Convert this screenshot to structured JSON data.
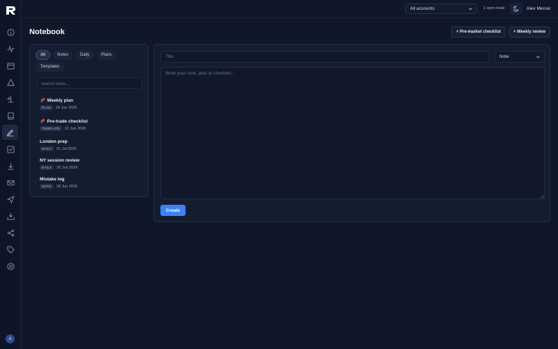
{
  "app": {
    "logo": "R"
  },
  "sidebar": {
    "icons": [
      "info-icon",
      "activity-icon",
      "calendar-icon",
      "warning-icon",
      "scale-icon",
      "book-icon",
      "pen-icon",
      "checklist-icon",
      "download-icon",
      "mail-icon",
      "send-icon",
      "inbox-icon",
      "share-icon",
      "tag-icon",
      "target-icon"
    ],
    "active": "pen-icon",
    "avatar_initial": "A"
  },
  "topbar": {
    "account_select": "All accounts",
    "open_trade": "1 open trade",
    "theme_icon": "moon-icon",
    "user_name": "Alex Mercer"
  },
  "page": {
    "title": "Notebook",
    "premarket_button": "+ Pre-market checklist",
    "weekly_button": "+ Weekly review"
  },
  "filters": {
    "tabs": [
      "All",
      "Notes",
      "Daily",
      "Plans",
      "Templates"
    ],
    "active": "All",
    "search_placeholder": "Search notes..."
  },
  "notes": [
    {
      "title": "Weekly plan",
      "pinned": true,
      "tag": "PLAN",
      "date": "29 Jun 2026"
    },
    {
      "title": "Pre-trade checklist",
      "pinned": true,
      "tag": "TEMPLATE",
      "date": "21 Jun 2026"
    },
    {
      "title": "London prep",
      "pinned": false,
      "tag": "DAILY",
      "date": "01 Jul 2026"
    },
    {
      "title": "NY session review",
      "pinned": false,
      "tag": "DAILY",
      "date": "30 Jun 2026"
    },
    {
      "title": "Mistake log",
      "pinned": false,
      "tag": "NOTE",
      "date": "28 Jun 2026"
    }
  ],
  "editor": {
    "title_placeholder": "Title",
    "type_select": "Note",
    "body_placeholder": "Write your note, plan or checklist...",
    "create_button": "Create"
  },
  "colors": {
    "accent": "#3b82f6",
    "pin": "#e2506a",
    "background": "#0f1728"
  }
}
